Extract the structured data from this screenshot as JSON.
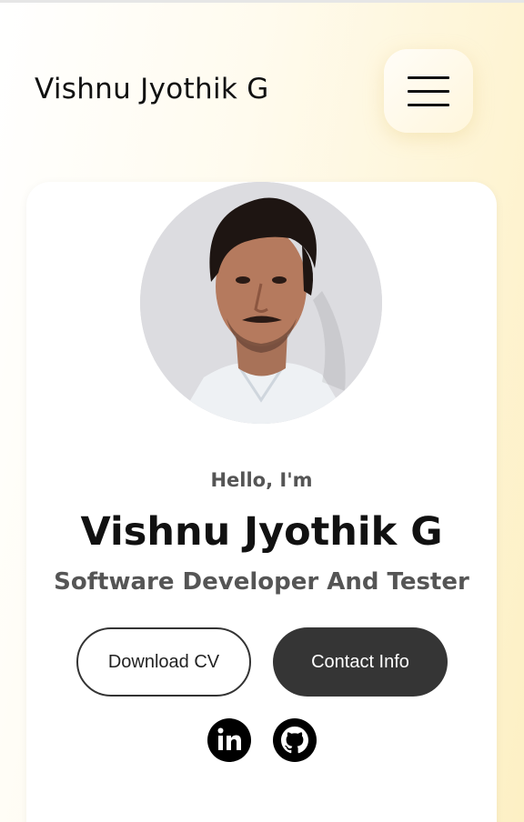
{
  "header": {
    "site_name": "Vishnu Jyothik G",
    "menu_icon": "hamburger-menu-icon"
  },
  "profile": {
    "avatar": "profile-photo",
    "greeting": "Hello, I'm",
    "name": "Vishnu Jyothik G",
    "role": "Software Developer And Tester"
  },
  "actions": {
    "download_cv": "Download CV",
    "contact_info": "Contact Info"
  },
  "socials": [
    {
      "name": "linkedin-icon"
    },
    {
      "name": "github-icon"
    }
  ],
  "colors": {
    "accent_gradient_end": "#fdf0c4",
    "card": "#ffffff",
    "button_dark": "#353535",
    "text_dark": "#111111",
    "text_muted": "#555555"
  }
}
